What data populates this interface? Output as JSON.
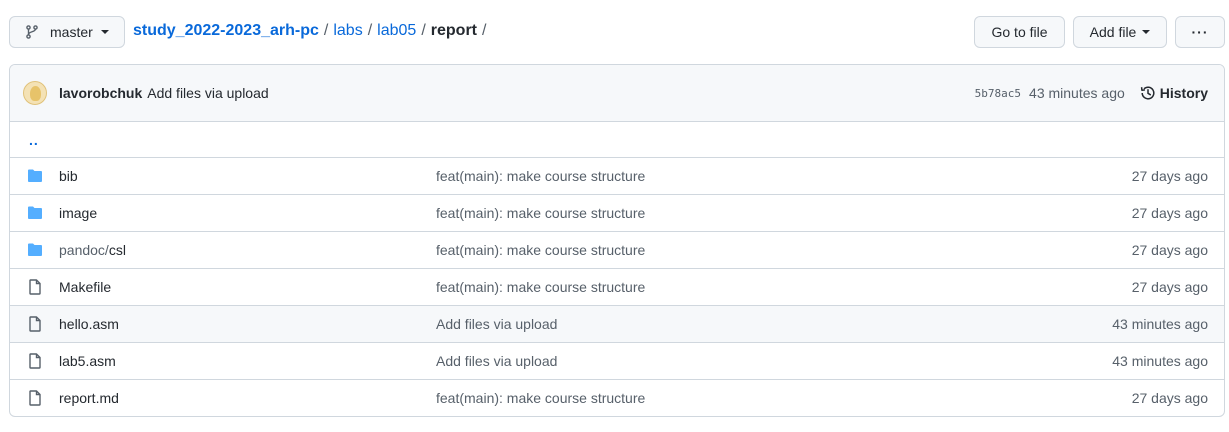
{
  "branch": {
    "name": "master",
    "icon": "git-branch-icon"
  },
  "breadcrumb": {
    "repo": "study_2022-2023_arh-pc",
    "parts": [
      "labs",
      "lab05"
    ],
    "current": "report",
    "separator": "/"
  },
  "toolbar": {
    "goto_label": "Go to file",
    "addfile_label": "Add file",
    "more_label": "···"
  },
  "commit": {
    "author": "lavorobchuk",
    "message": "Add files via upload",
    "sha": "5b78ac5",
    "time": "43 minutes ago",
    "history_label": "History"
  },
  "files": {
    "parent_label": "..",
    "rows": [
      {
        "type": "folder",
        "name": "bib",
        "message": "feat(main): make course structure",
        "age": "27 days ago"
      },
      {
        "type": "folder",
        "name": "image",
        "message": "feat(main): make course structure",
        "age": "27 days ago"
      },
      {
        "type": "folder",
        "name_prefix": "pandoc/",
        "name": "csl",
        "message": "feat(main): make course structure",
        "age": "27 days ago"
      },
      {
        "type": "file",
        "name": "Makefile",
        "message": "feat(main): make course structure",
        "age": "27 days ago"
      },
      {
        "type": "file",
        "name": "hello.asm",
        "message": "Add files via upload",
        "age": "43 minutes ago"
      },
      {
        "type": "file",
        "name": "lab5.asm",
        "message": "Add files via upload",
        "age": "43 minutes ago"
      },
      {
        "type": "file",
        "name": "report.md",
        "message": "feat(main): make course structure",
        "age": "27 days ago"
      }
    ]
  },
  "colors": {
    "link": "#0969da",
    "folder": "#54aeff",
    "muted": "#57606a",
    "border": "#d0d7de"
  }
}
